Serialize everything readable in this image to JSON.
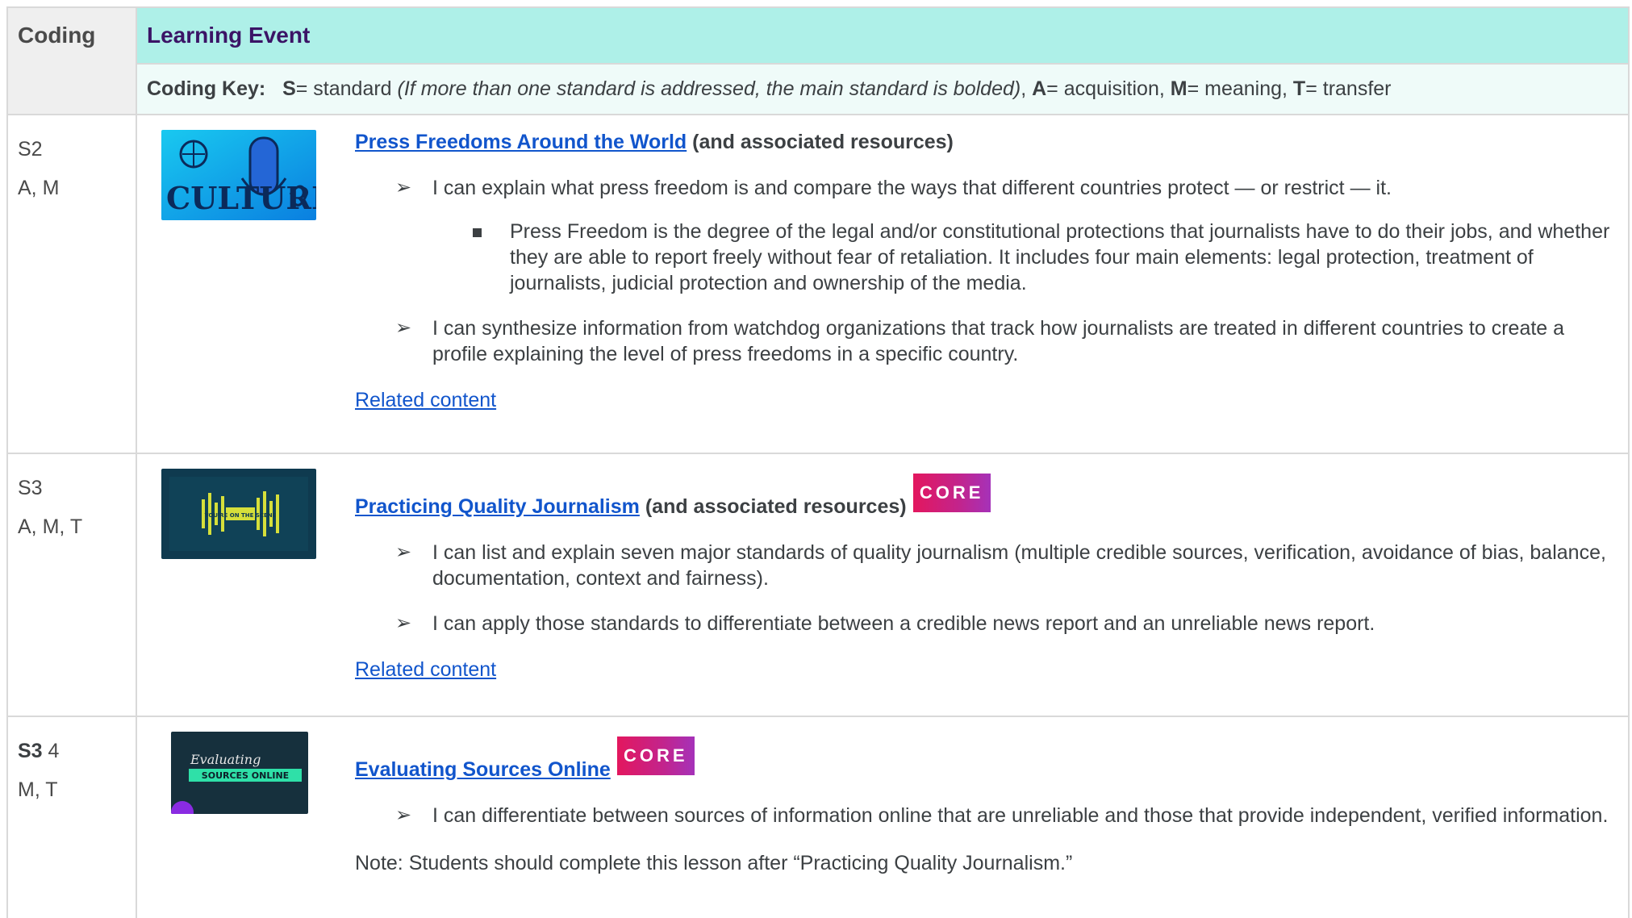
{
  "header": {
    "coding_label": "Coding",
    "event_label": "Learning Event",
    "key": {
      "prefix": "Coding Key:",
      "s_letter": "S",
      "s_text": "= standard ",
      "s_note": "(If more than one standard is addressed, the main standard is bolded)",
      "sep1": ",  ",
      "a_letter": "A",
      "a_text": "= acquisition,  ",
      "m_letter": "M",
      "m_text": "= meaning,  ",
      "t_letter": "T",
      "t_text": "= transfer"
    }
  },
  "rows": [
    {
      "code_line1": "S2",
      "code_line2": "A, M",
      "thumb_text": "CULTURE OF FEAR",
      "title_link": "Press Freedoms Around the World",
      "title_suffix": " (and associated resources)",
      "bullets": [
        "I can explain what press freedom is and compare the ways that different countries protect — or restrict — it.",
        "I can synthesize information from watchdog organizations that track how journalists are treated in different countries to create a profile explaining the level of press freedoms in a specific country."
      ],
      "sub_bullet": "Press Freedom is the degree of the legal and/or constitutional protections that journalists have to do their jobs, and whether they are able to report freely without fear of retaliation. It includes four main elements: legal protection, treatment of journalists, judicial protection and ownership of the media.",
      "related": "Related content"
    },
    {
      "code_line1": "S3",
      "code_line2": "A, M, T",
      "thumb_text": "YOU'RE ON THE SCENE",
      "title_link": "Practicing Quality Journalism",
      "title_suffix": " (and associated resources)",
      "core_label": "CORE",
      "bullets": [
        "I can list and explain seven major standards of quality journalism (multiple credible sources, verification, avoidance of bias, balance, documentation, context and fairness).",
        "I can apply those standards to differentiate between a credible news report and an unreliable news report."
      ],
      "related": "Related content"
    },
    {
      "code_bold": "S3",
      "code_rest": " 4",
      "code_line2": "M, T",
      "thumb_text_1": "Evaluating",
      "thumb_text_2": "SOURCES ONLINE",
      "title_link": "Evaluating Sources Online",
      "core_label": "CORE",
      "bullets": [
        "I can differentiate between sources of information online that are unreliable and those that provide independent, verified information."
      ],
      "note": "Note: Students should complete this lesson after “Practicing Quality Journalism.”"
    }
  ],
  "colors": {
    "header_bg": "#aef0e8",
    "key_bg": "#effbf9",
    "link": "#1155cc",
    "core_start": "#e3175e",
    "core_end": "#a532b9"
  }
}
